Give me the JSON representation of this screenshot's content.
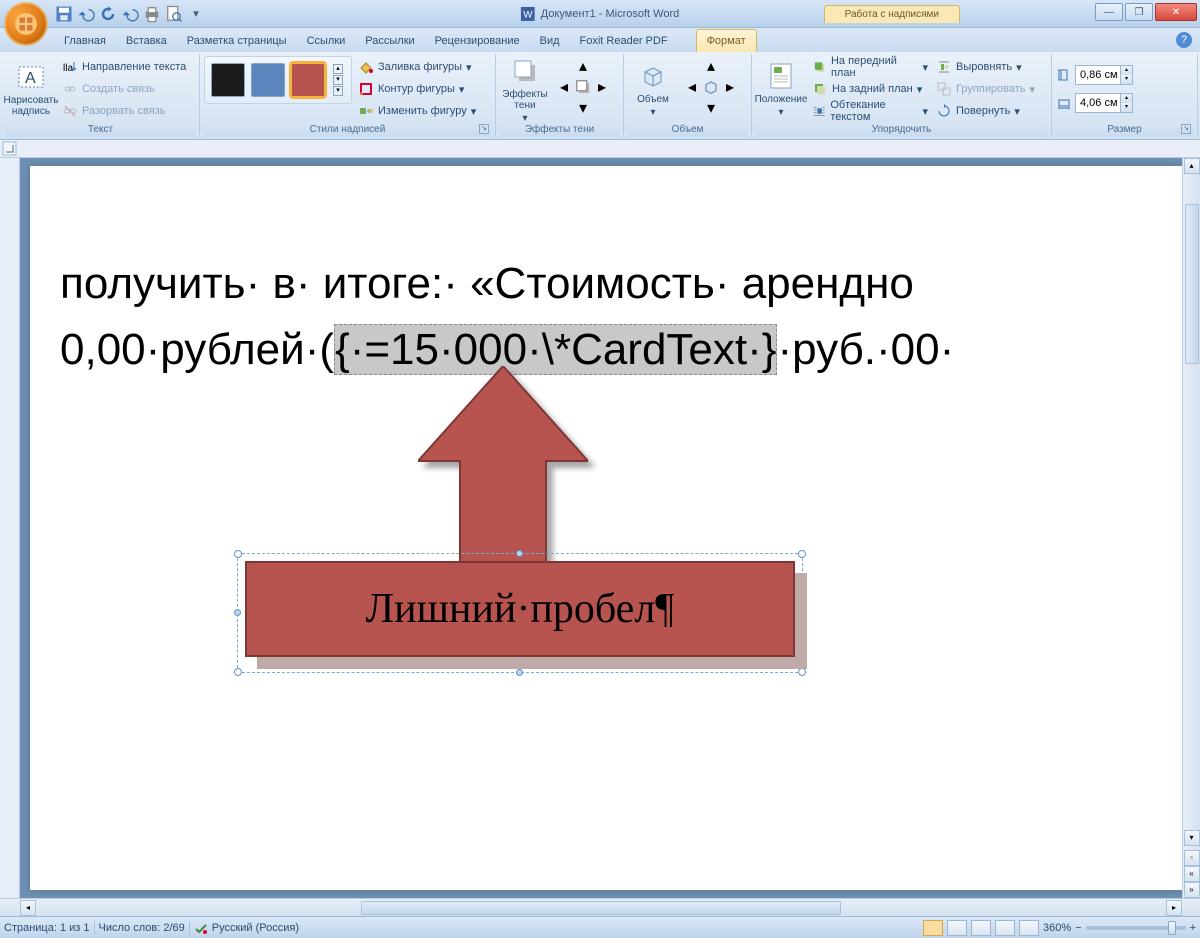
{
  "window": {
    "title_doc": "Документ1 - Microsoft Word",
    "context_title": "Работа с надписями"
  },
  "qat_tips": [
    "save",
    "undo",
    "redo",
    "sync",
    "print",
    "preview"
  ],
  "tabs": {
    "items": [
      "Главная",
      "Вставка",
      "Разметка страницы",
      "Ссылки",
      "Рассылки",
      "Рецензирование",
      "Вид",
      "Foxit Reader PDF"
    ],
    "context": "Формат"
  },
  "ribbon": {
    "g_text": {
      "label": "Текст",
      "draw": "Нарисовать\nнадпись",
      "dir": "Направление текста",
      "link": "Создать связь",
      "unlink": "Разорвать связь"
    },
    "g_styles": {
      "label": "Стили надписей",
      "fill": "Заливка фигуры",
      "outline": "Контур фигуры",
      "change": "Изменить фигуру",
      "colors": [
        "#1b1b1b",
        "#5a85bd",
        "#b85450"
      ]
    },
    "g_shadow": {
      "label": "Эффекты тени",
      "btn": "Эффекты\nтени"
    },
    "g_3d": {
      "label": "Объем",
      "btn": "Объем"
    },
    "g_arrange": {
      "label": "Упорядочить",
      "pos": "Положение",
      "front": "На передний план",
      "back": "На задний план",
      "wrap": "Обтекание текстом",
      "align": "Выровнять",
      "group": "Группировать",
      "rotate": "Повернуть"
    },
    "g_size": {
      "label": "Размер",
      "h": "0,86 см",
      "w": "4,06 см"
    }
  },
  "document": {
    "line1_a": "получить· в· итоге:· «Стоимость· арендно",
    "line2_a": "0,00·рублей·(",
    "field": "{·=15·000·\\*CardText·}",
    "line2_b": "·руб.·00·",
    "callout": "Лишний·пробел¶"
  },
  "status": {
    "page": "Страница: 1 из 1",
    "words": "Число слов: 2/69",
    "lang": "Русский (Россия)",
    "zoom": "360%"
  }
}
